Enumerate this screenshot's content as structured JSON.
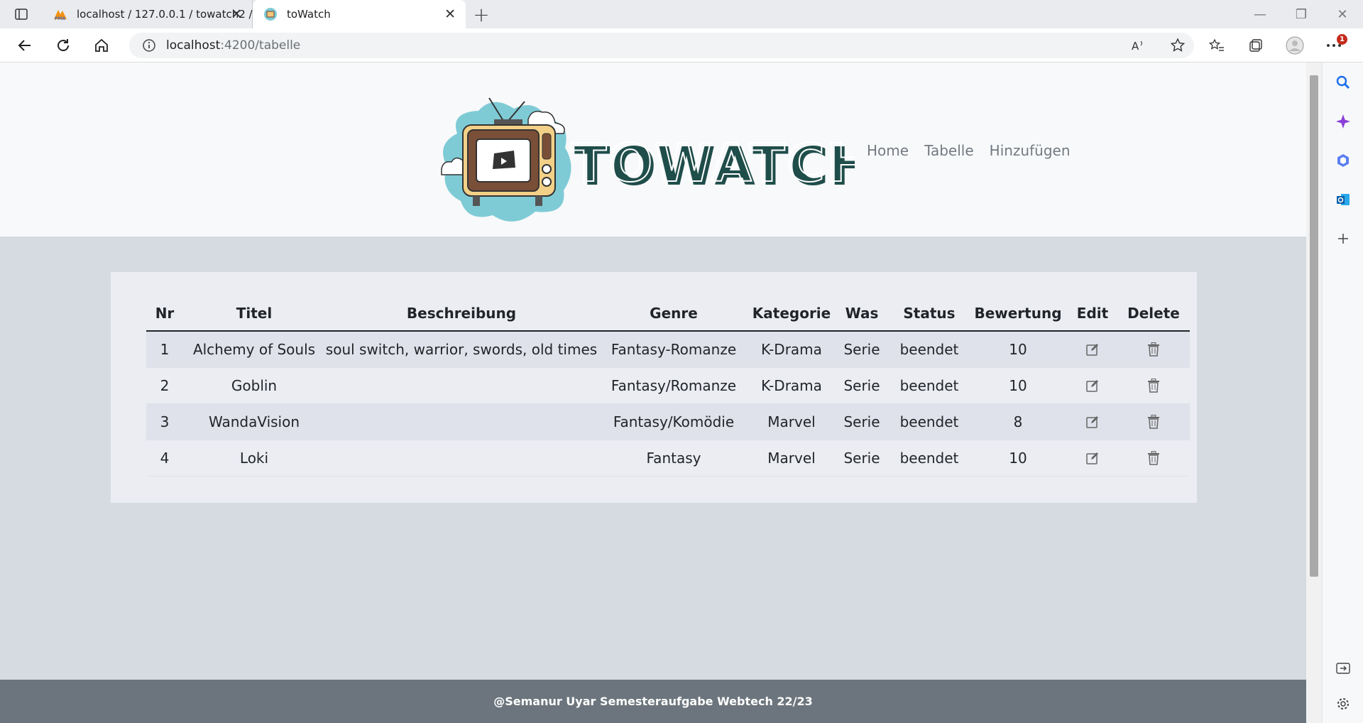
{
  "browser": {
    "tabs": [
      {
        "title": "localhost / 127.0.0.1 / towatch2 /"
      },
      {
        "title": "toWatch"
      }
    ],
    "url_host": "localhost",
    "url_path": ":4200/tabelle",
    "notification_count": "1"
  },
  "site": {
    "logo_text": "TOWATCH",
    "nav": [
      "Home",
      "Tabelle",
      "Hinzufügen"
    ]
  },
  "table": {
    "headers": [
      "Nr",
      "Titel",
      "Beschreibung",
      "Genre",
      "Kategorie",
      "Was",
      "Status",
      "Bewertung",
      "Edit",
      "Delete"
    ],
    "rows": [
      {
        "nr": "1",
        "titel": "Alchemy of Souls",
        "beschreibung": "soul switch, warrior, swords, old times",
        "genre": "Fantasy-Romanze",
        "kategorie": "K-Drama",
        "was": "Serie",
        "status": "beendet",
        "bewertung": "10"
      },
      {
        "nr": "2",
        "titel": "Goblin",
        "beschreibung": "",
        "genre": "Fantasy/Romanze",
        "kategorie": "K-Drama",
        "was": "Serie",
        "status": "beendet",
        "bewertung": "10"
      },
      {
        "nr": "3",
        "titel": "WandaVision",
        "beschreibung": "",
        "genre": "Fantasy/Komödie",
        "kategorie": "Marvel",
        "was": "Serie",
        "status": "beendet",
        "bewertung": "8"
      },
      {
        "nr": "4",
        "titel": "Loki",
        "beschreibung": "",
        "genre": "Fantasy",
        "kategorie": "Marvel",
        "was": "Serie",
        "status": "beendet",
        "bewertung": "10"
      }
    ]
  },
  "footer": {
    "text": "@Semanur Uyar Semesteraufgabe Webtech 22/23"
  },
  "icons": {
    "edit": "edit-icon",
    "delete": "trash-icon"
  },
  "colors": {
    "logo_dark": "#1f4d4a",
    "cloud": "#7ecbd6",
    "footer_bg": "#6c757d",
    "page_bg": "#d6dbe2"
  }
}
